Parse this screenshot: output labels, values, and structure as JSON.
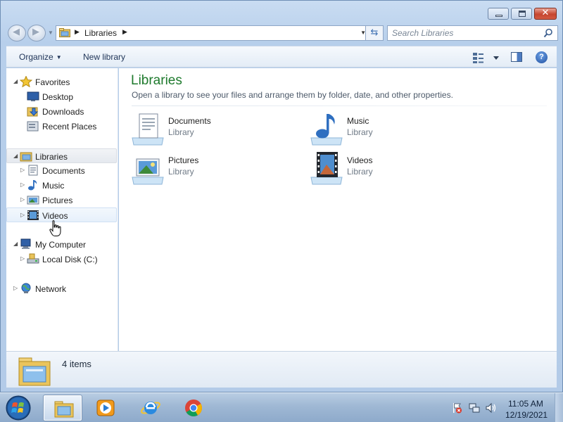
{
  "window": {
    "buttons": [
      "minimize",
      "maximize",
      "close"
    ]
  },
  "address": {
    "location": "Libraries",
    "search_placeholder": "Search Libraries"
  },
  "toolbar": {
    "organize_label": "Organize",
    "new_library_label": "New library"
  },
  "nav": {
    "favorites": {
      "label": "Favorites",
      "items": [
        {
          "label": "Desktop",
          "icon": "desktop-icon"
        },
        {
          "label": "Downloads",
          "icon": "downloads-icon"
        },
        {
          "label": "Recent Places",
          "icon": "recent-places-icon"
        }
      ]
    },
    "libraries": {
      "label": "Libraries",
      "items": [
        {
          "label": "Documents",
          "icon": "documents-icon"
        },
        {
          "label": "Music",
          "icon": "music-icon"
        },
        {
          "label": "Pictures",
          "icon": "pictures-icon"
        },
        {
          "label": "Videos",
          "icon": "videos-icon"
        }
      ]
    },
    "computer": {
      "label": "My Computer",
      "items": [
        {
          "label": "Local Disk (C:)",
          "icon": "hard-disk-icon"
        }
      ]
    },
    "network": {
      "label": "Network"
    }
  },
  "content": {
    "title": "Libraries",
    "subtitle": "Open a library to see your files and arrange them by folder, date, and other properties.",
    "libraries": [
      {
        "name": "Documents",
        "type": "Library",
        "icon": "documents-library-icon"
      },
      {
        "name": "Music",
        "type": "Library",
        "icon": "music-library-icon"
      },
      {
        "name": "Pictures",
        "type": "Library",
        "icon": "pictures-library-icon"
      },
      {
        "name": "Videos",
        "type": "Library",
        "icon": "videos-library-icon"
      }
    ]
  },
  "details": {
    "item_count": "4 items"
  },
  "taskbar": {
    "apps": [
      "windows-explorer-icon",
      "media-player-icon",
      "internet-explorer-icon",
      "chrome-icon"
    ],
    "clock": {
      "time": "11:05 AM",
      "date": "12/19/2021"
    }
  },
  "colors": {
    "title_green": "#1e7a2d",
    "accent_blue": "#3c6fb2"
  }
}
